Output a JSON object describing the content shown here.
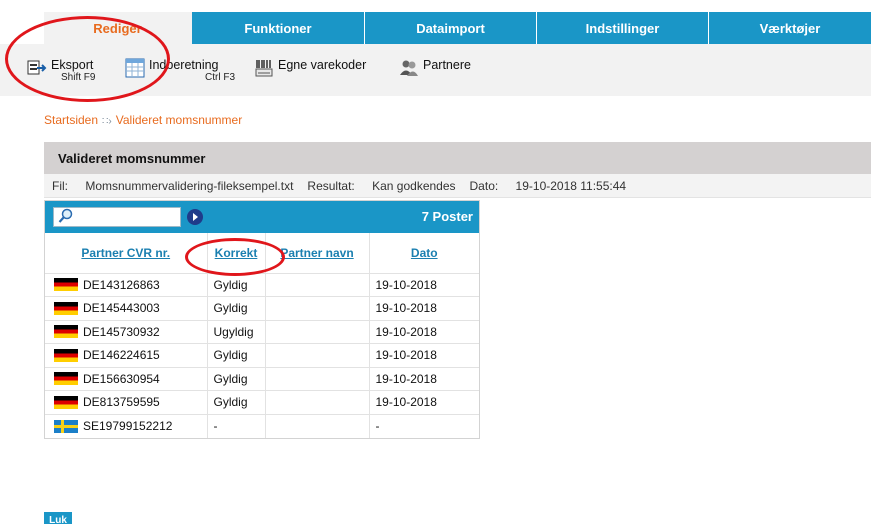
{
  "tabs": [
    {
      "label": "Rediger",
      "active": true
    },
    {
      "label": "Funktioner",
      "active": false
    },
    {
      "label": "Dataimport",
      "active": false
    },
    {
      "label": "Indstillinger",
      "active": false
    },
    {
      "label": "Værktøjer",
      "active": false
    }
  ],
  "toolbar": {
    "export": {
      "label": "Eksport",
      "shortcut": "Shift F9",
      "icon": "export-icon"
    },
    "report": {
      "label": "Indberetning",
      "shortcut": "Ctrl F3",
      "icon": "calendar-grid-icon"
    },
    "codes": {
      "label": "Egne varekoder",
      "icon": "barcode-icon"
    },
    "partners": {
      "label": "Partnere",
      "icon": "partners-icon"
    }
  },
  "breadcrumb": {
    "home": "Startsiden",
    "current": "Valideret momsnummer"
  },
  "section": {
    "title": "Valideret momsnummer",
    "file_label": "Fil:",
    "file_value": "Momsnummervalidering-fileksempel.txt",
    "result_label": "Resultat:",
    "result_value": "Kan godkendes",
    "date_label": "Dato:",
    "date_value": "19-10-2018 11:55:44"
  },
  "grid": {
    "search_placeholder": "",
    "count": "7 Poster",
    "columns": [
      "Partner CVR nr.",
      "Korrekt",
      "Partner navn",
      "Dato"
    ],
    "rows": [
      {
        "flag": "de",
        "cvr": "DE143126863",
        "korrekt": "Gyldig",
        "navn": "",
        "dato": "19-10-2018"
      },
      {
        "flag": "de",
        "cvr": "DE145443003",
        "korrekt": "Gyldig",
        "navn": "",
        "dato": "19-10-2018"
      },
      {
        "flag": "de",
        "cvr": "DE145730932",
        "korrekt": "Ugyldig",
        "navn": "",
        "dato": "19-10-2018"
      },
      {
        "flag": "de",
        "cvr": "DE146224615",
        "korrekt": "Gyldig",
        "navn": "",
        "dato": "19-10-2018"
      },
      {
        "flag": "de",
        "cvr": "DE156630954",
        "korrekt": "Gyldig",
        "navn": "",
        "dato": "19-10-2018"
      },
      {
        "flag": "de",
        "cvr": "DE813759595",
        "korrekt": "Gyldig",
        "navn": "",
        "dato": "19-10-2018"
      },
      {
        "flag": "se",
        "cvr": "SE19799152212",
        "korrekt": "-",
        "navn": "",
        "dato": "-"
      }
    ]
  },
  "close_button": "Luk",
  "colors": {
    "brand_blue": "#1a96c7",
    "accent_orange": "#e86b1f",
    "annotation_red": "#e0161b"
  }
}
